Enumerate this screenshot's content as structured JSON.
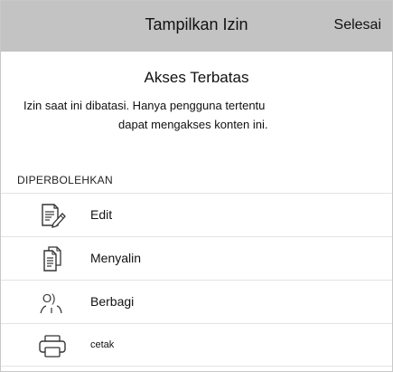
{
  "header": {
    "title": "Tampilkan Izin",
    "done_label": "Selesai"
  },
  "info": {
    "heading": "Akses Terbatas",
    "description_line1": "Izin saat ini dibatasi. Hanya pengguna tertentu",
    "description_line2": "dapat mengakses konten ini."
  },
  "permissions": {
    "section_label": "DIPERBOLEHKAN",
    "items": [
      {
        "label": "Edit",
        "icon": "edit-document-icon"
      },
      {
        "label": "Menyalin",
        "icon": "copy-document-icon"
      },
      {
        "label": "Berbagi",
        "icon": "share-people-icon"
      },
      {
        "label": "cetak",
        "icon": "printer-icon"
      }
    ]
  }
}
